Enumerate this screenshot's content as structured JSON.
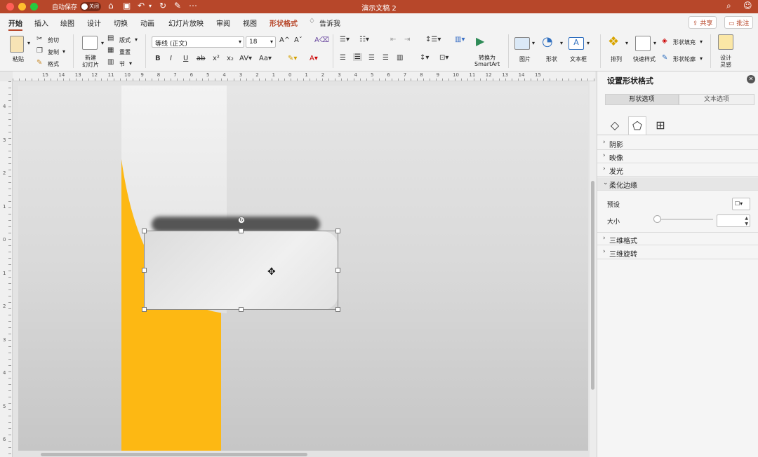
{
  "titlebar": {
    "autosave_label": "自动保存",
    "autosave_state": "关闭",
    "doc_title": "演示文稿 2",
    "more": "⋯"
  },
  "tabs": [
    "开始",
    "插入",
    "绘图",
    "设计",
    "切换",
    "动画",
    "幻灯片放映",
    "审阅",
    "视图",
    "形状格式"
  ],
  "tell_me": "告诉我",
  "share_label": "共享",
  "comment_label": "批注",
  "ribbon": {
    "paste": "粘贴",
    "cut": "剪切",
    "copy": "复制",
    "format": "格式",
    "new_slide_1": "新建",
    "new_slide_2": "幻灯片",
    "layout": "版式",
    "reset": "重置",
    "section": "节",
    "font_name": "等线 (正文)",
    "font_size": "18",
    "convert_1": "转换为",
    "convert_2": "SmartArt",
    "picture": "图片",
    "shape": "形状",
    "textbox": "文本框",
    "arrange": "排列",
    "quick_styles": "快速样式",
    "shape_fill": "形状填充",
    "shape_outline": "形状轮廓",
    "designer_1": "设计",
    "designer_2": "灵感"
  },
  "hruler_ticks": [
    "15",
    "14",
    "13",
    "12",
    "11",
    "10",
    "9",
    "8",
    "7",
    "6",
    "5",
    "4",
    "3",
    "2",
    "1",
    "0",
    "1",
    "2",
    "3",
    "4",
    "5",
    "6",
    "7",
    "8",
    "9",
    "10",
    "11",
    "12",
    "13",
    "14",
    "15"
  ],
  "vruler_ticks": [
    "4",
    "3",
    "2",
    "1",
    "0",
    "1",
    "2",
    "3",
    "4",
    "5",
    "6"
  ],
  "pane": {
    "title": "设置形状格式",
    "tab_shape": "形状选项",
    "tab_text": "文本选项",
    "sections": [
      "阴影",
      "映像",
      "发光",
      "柔化边缘",
      "三维格式",
      "三维旋转"
    ],
    "preset_label": "预设",
    "size_label": "大小"
  },
  "colors": {
    "brand": "#b7472a",
    "accent_yellow": "#fdb813"
  }
}
